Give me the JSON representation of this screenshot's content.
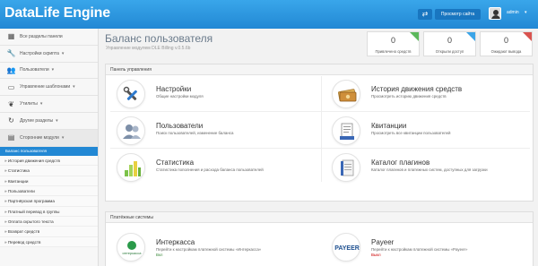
{
  "header": {
    "logo": "DataLife Engine",
    "swap_icon": "⇄",
    "view_site": "Просмотр сайта",
    "user": "admin"
  },
  "sidebar": {
    "items": [
      {
        "label": "Все разделы панели",
        "icon": "grid-icon"
      },
      {
        "label": "Настройки скрипта",
        "icon": "wrench-icon"
      },
      {
        "label": "Пользователи",
        "icon": "users-icon"
      },
      {
        "label": "Управление шаблонами",
        "icon": "monitor-icon"
      },
      {
        "label": "Утилиты",
        "icon": "leaf-icon"
      },
      {
        "label": "Другие разделы",
        "icon": "refresh-icon"
      },
      {
        "label": "Сторонние модули",
        "icon": "document-icon"
      }
    ],
    "active_sub": "Баланс пользователя",
    "sub_items": [
      "» История движения средств",
      "» Статистика",
      "» Квитанции",
      "» Пользователи",
      "» Партнёрская программа",
      "» Платный перевод в группы",
      "» Оплата скрытого текста",
      "» Возврат средств",
      "» Перевод средств"
    ]
  },
  "page": {
    "title": "Баланс пользователя",
    "subtitle": "Управление модулем DLE Billing v.0.5.6b"
  },
  "stats": [
    {
      "value": "0",
      "label": "Привлечено средств",
      "color": "#5cb85c"
    },
    {
      "value": "0",
      "label": "Открыли доступ",
      "color": "#3ba5e8"
    },
    {
      "value": "0",
      "label": "Ожидают вывода",
      "color": "#d9534f"
    }
  ],
  "control_panel": {
    "heading": "Панель управления",
    "tiles": [
      {
        "title": "Настройки",
        "desc": "Общие настройки модуля",
        "icon": "tools-icon"
      },
      {
        "title": "История движения средств",
        "desc": "Просмотреть историю движения средств",
        "icon": "money-icon"
      },
      {
        "title": "Пользователи",
        "desc": "Поиск пользователей, изменение баланса",
        "icon": "users-icon"
      },
      {
        "title": "Квитанции",
        "desc": "Просмотреть все квитанции пользователей",
        "icon": "receipt-icon"
      },
      {
        "title": "Статистика",
        "desc": "Статистика пополнения и расхода баланса пользователей",
        "icon": "bar-chart-icon"
      },
      {
        "title": "Каталог плагинов",
        "desc": "Каталог плагинов и платежных систем, доступных для загрузки",
        "icon": "catalog-icon"
      }
    ]
  },
  "payment_systems": {
    "heading": "Платёжные системы",
    "items": [
      {
        "title": "Интеркасса",
        "desc": "Перейти к настройкам платежной системы «Интеркасса»",
        "status": "Вкл",
        "status_color": "#3a8a3a",
        "logo_text": "интеркасса"
      },
      {
        "title": "Payeer",
        "desc": "Перейти к настройкам платежной системы «Payeer»",
        "status": "Выкл",
        "status_color": "#cc0000",
        "logo_text": "PAYEER"
      }
    ]
  }
}
